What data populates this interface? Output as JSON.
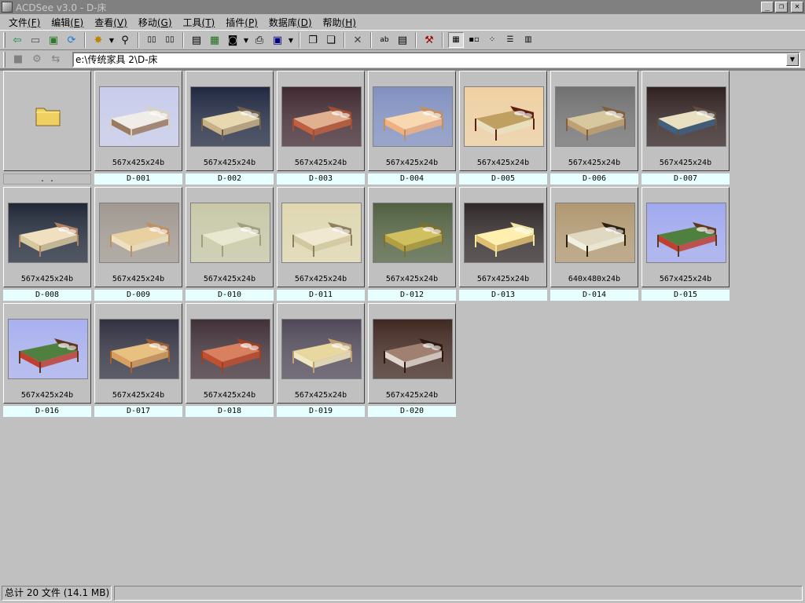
{
  "window": {
    "title": "ACDSee v3.0 - D-床"
  },
  "menu": [
    {
      "label": "文件",
      "acc": "(F)"
    },
    {
      "label": "编辑",
      "acc": "(E)"
    },
    {
      "label": "查看",
      "acc": "(V)"
    },
    {
      "label": "移动",
      "acc": "(G)"
    },
    {
      "label": "工具",
      "acc": "(T)"
    },
    {
      "label": "插件",
      "acc": "(P)"
    },
    {
      "label": "数据库",
      "acc": "(D)"
    },
    {
      "label": "帮助",
      "acc": "(H)"
    }
  ],
  "address": {
    "value": "e:\\传统家具 2\\D-床"
  },
  "parent": {
    "label": ". ."
  },
  "files": [
    {
      "name": "D-001",
      "dims": "567x425x24b"
    },
    {
      "name": "D-002",
      "dims": "567x425x24b"
    },
    {
      "name": "D-003",
      "dims": "567x425x24b"
    },
    {
      "name": "D-004",
      "dims": "567x425x24b"
    },
    {
      "name": "D-005",
      "dims": "567x425x24b"
    },
    {
      "name": "D-006",
      "dims": "567x425x24b"
    },
    {
      "name": "D-007",
      "dims": "567x425x24b"
    },
    {
      "name": "D-008",
      "dims": "567x425x24b"
    },
    {
      "name": "D-009",
      "dims": "567x425x24b"
    },
    {
      "name": "D-010",
      "dims": "567x425x24b"
    },
    {
      "name": "D-011",
      "dims": "567x425x24b"
    },
    {
      "name": "D-012",
      "dims": "567x425x24b"
    },
    {
      "name": "D-013",
      "dims": "567x425x24b"
    },
    {
      "name": "D-014",
      "dims": "640x480x24b"
    },
    {
      "name": "D-015",
      "dims": "567x425x24b"
    },
    {
      "name": "D-016",
      "dims": "567x425x24b"
    },
    {
      "name": "D-017",
      "dims": "567x425x24b"
    },
    {
      "name": "D-018",
      "dims": "567x425x24b"
    },
    {
      "name": "D-019",
      "dims": "567x425x24b"
    },
    {
      "name": "D-020",
      "dims": "567x425x24b"
    }
  ],
  "status": {
    "summary": "总计 20 文件 (14.1 MB)"
  }
}
